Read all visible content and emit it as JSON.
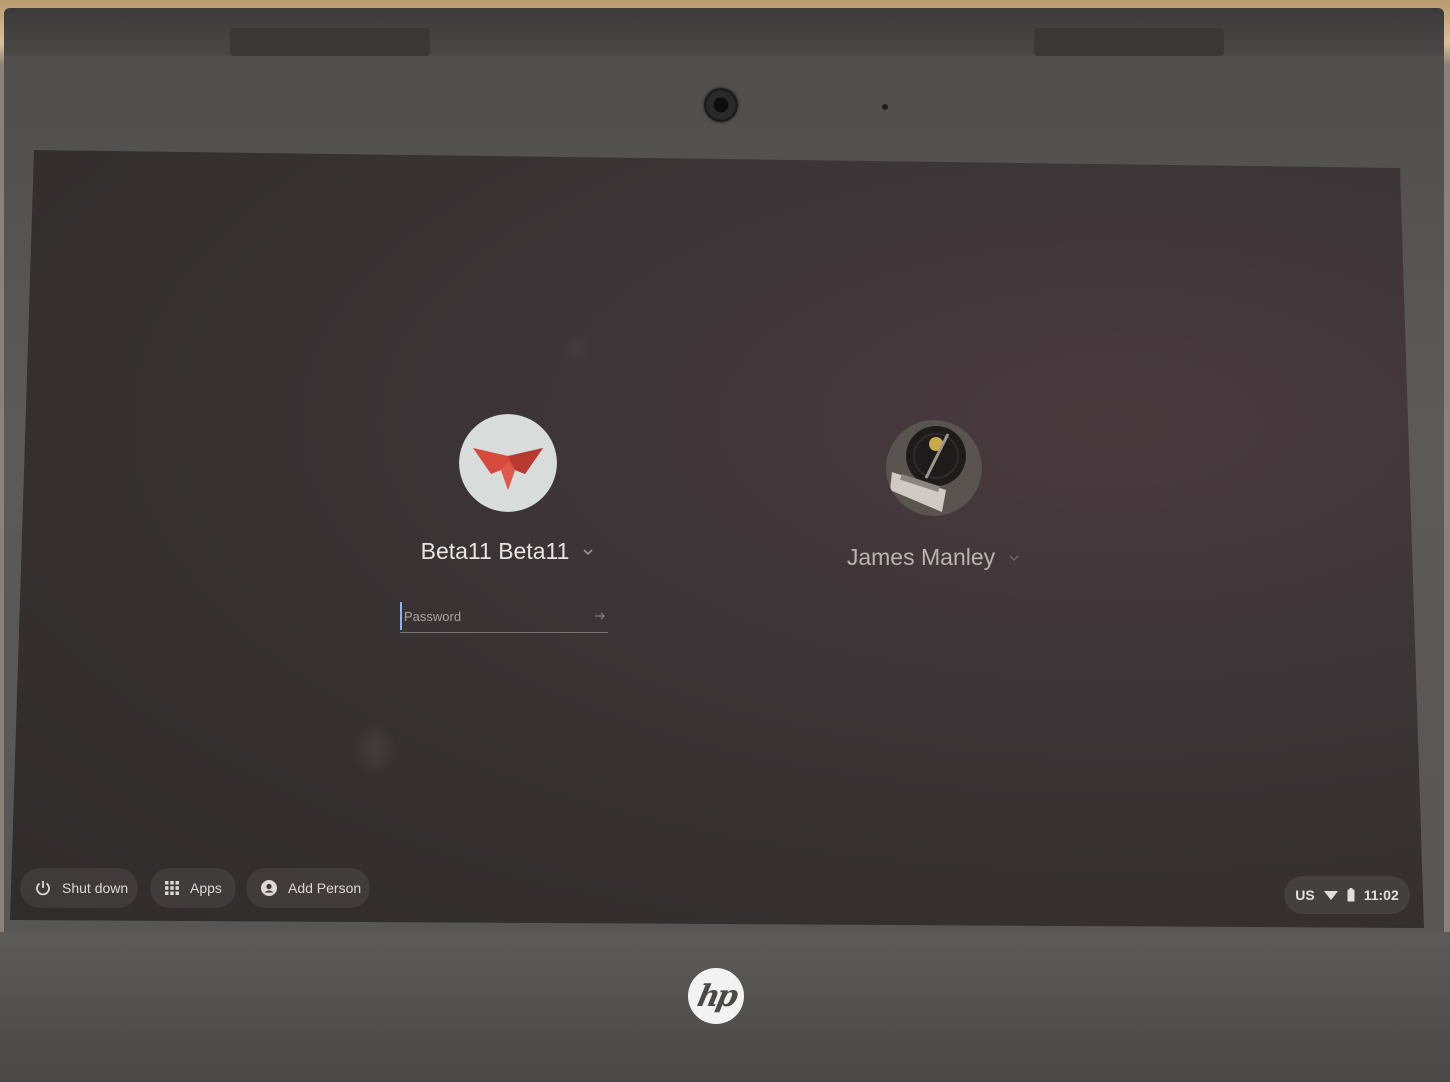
{
  "login": {
    "users": [
      {
        "name": "Beta11 Beta11",
        "avatar": "red-origami-butterfly-avatar",
        "password_placeholder": "Password",
        "password_value": ""
      },
      {
        "name": "James Manley",
        "avatar": "record-player-avatar"
      }
    ]
  },
  "shelf": {
    "shutdown_label": "Shut down",
    "apps_label": "Apps",
    "add_person_label": "Add Person"
  },
  "status_tray": {
    "keyboard_layout": "US",
    "wifi_icon": "wifi-icon",
    "battery_icon": "battery-icon",
    "time": "11:02"
  },
  "device": {
    "brand_logo": "hp"
  },
  "colors": {
    "screen_bg": "#35302f",
    "avatar_red": "#d64a3e",
    "focus_blue": "#8ab4f8"
  }
}
